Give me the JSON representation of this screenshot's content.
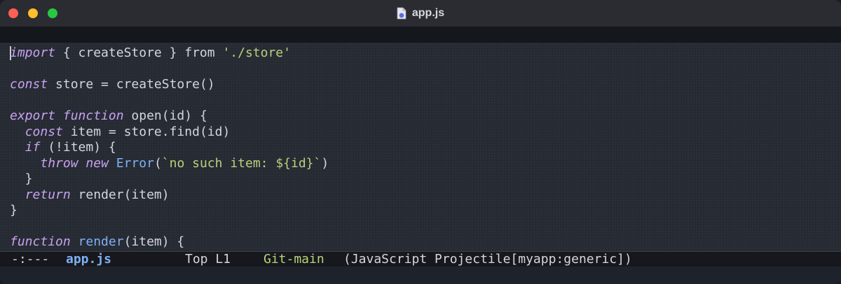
{
  "window": {
    "title": "app.js",
    "file_icon": "javascript-file-icon"
  },
  "editor": {
    "lines": [
      [
        {
          "t": "import",
          "c": "kw"
        },
        {
          "t": " { createStore } from "
        },
        {
          "t": "'./store'",
          "c": "str"
        }
      ],
      [],
      [
        {
          "t": "const",
          "c": "kw"
        },
        {
          "t": " store = createStore()"
        }
      ],
      [],
      [
        {
          "t": "export",
          "c": "kw"
        },
        {
          "t": " "
        },
        {
          "t": "function",
          "c": "kw"
        },
        {
          "t": " open(id) {"
        }
      ],
      [
        {
          "t": "  "
        },
        {
          "t": "const",
          "c": "kw"
        },
        {
          "t": " item = store.find(id)"
        }
      ],
      [
        {
          "t": "  "
        },
        {
          "t": "if",
          "c": "kw"
        },
        {
          "t": " (!item) {"
        }
      ],
      [
        {
          "t": "    "
        },
        {
          "t": "throw",
          "c": "kw"
        },
        {
          "t": " "
        },
        {
          "t": "new",
          "c": "kw"
        },
        {
          "t": " "
        },
        {
          "t": "Error",
          "c": "fn"
        },
        {
          "t": "("
        },
        {
          "t": "`no such item: ${id}`",
          "c": "str"
        },
        {
          "t": ")"
        }
      ],
      [
        {
          "t": "  }"
        }
      ],
      [
        {
          "t": "  "
        },
        {
          "t": "return",
          "c": "kw"
        },
        {
          "t": " render(item)"
        }
      ],
      [
        {
          "t": "}"
        }
      ],
      [],
      [
        {
          "t": "function",
          "c": "kw"
        },
        {
          "t": " "
        },
        {
          "t": "render",
          "c": "fn"
        },
        {
          "t": "(item) {"
        }
      ]
    ]
  },
  "modeline": {
    "status": "-:---",
    "buffer": "app.js",
    "position": "Top L1",
    "vc": "Git-main",
    "modes": "(JavaScript Projectile[myapp:generic])"
  },
  "colors": {
    "keyword": "#c8a2f0",
    "function": "#7fb0f5",
    "string": "#b9d27a",
    "text": "#d4d6dc"
  }
}
